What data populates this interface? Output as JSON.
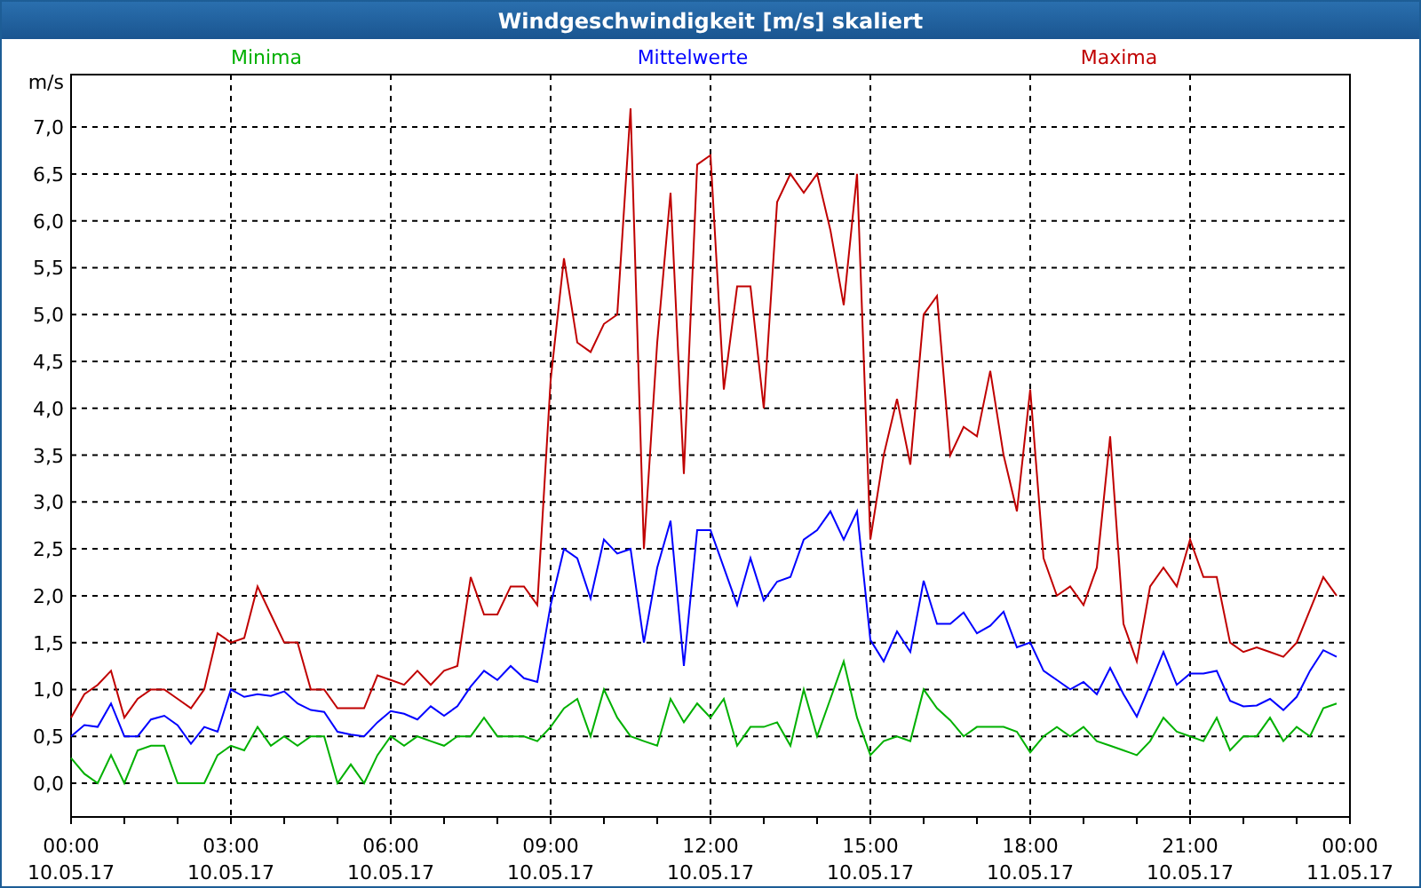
{
  "chart": {
    "chart_data": {
      "type": "line",
      "title": "Windgeschwindigkeit [m/s] skaliert",
      "ylabel": "m/s",
      "categories": [
        "00:00\n10.05.17",
        null,
        null,
        null,
        null,
        null,
        null,
        null,
        null,
        null,
        null,
        null,
        "03:00\n10.05.17",
        null,
        null,
        null,
        null,
        null,
        null,
        null,
        null,
        null,
        null,
        null,
        "06:00\n10.05.17",
        null,
        null,
        null,
        null,
        null,
        null,
        null,
        null,
        null,
        null,
        null,
        "09:00\n10.05.17",
        null,
        null,
        null,
        null,
        null,
        null,
        null,
        null,
        null,
        null,
        null,
        "12:00\n10.05.17",
        null,
        null,
        null,
        null,
        null,
        null,
        null,
        null,
        null,
        null,
        null,
        "15:00\n10.05.17",
        null,
        null,
        null,
        null,
        null,
        null,
        null,
        null,
        null,
        null,
        null,
        "18:00\n10.05.17",
        null,
        null,
        null,
        null,
        null,
        null,
        null,
        null,
        null,
        null,
        null,
        "21:00\n10.05.17",
        null,
        null,
        null,
        null,
        null,
        null,
        null,
        null,
        null,
        null,
        null,
        "00:00\n11.05.17"
      ],
      "series": [
        {
          "name": "Minima",
          "color": "#00b000",
          "values": [
            0.27,
            0.1,
            0.0,
            0.3,
            0.0,
            0.35,
            0.4,
            0.4,
            0.0,
            0.0,
            0.0,
            0.3,
            0.4,
            0.35,
            0.6,
            0.4,
            0.5,
            0.4,
            0.5,
            0.5,
            0.0,
            0.2,
            0.0,
            0.3,
            0.5,
            0.4,
            0.5,
            0.45,
            0.4,
            0.5,
            0.5,
            0.7,
            0.5,
            0.5,
            0.5,
            0.45,
            0.6,
            0.8,
            0.9,
            0.5,
            1.0,
            0.7,
            0.5,
            0.45,
            0.4,
            0.9,
            0.65,
            0.85,
            0.7,
            0.9,
            0.4,
            0.6,
            0.6,
            0.65,
            0.4,
            1.0,
            0.5,
            0.9,
            1.3,
            0.7,
            0.3,
            0.45,
            0.5,
            0.45,
            1.0,
            0.8,
            0.67,
            0.5,
            0.6,
            0.6,
            0.6,
            0.55,
            0.33,
            0.5,
            0.6,
            0.5,
            0.6,
            0.45,
            0.4,
            0.35,
            0.3,
            0.45,
            0.7,
            0.55,
            0.5,
            0.45,
            0.7,
            0.35,
            0.5,
            0.5,
            0.7,
            0.45,
            0.6,
            0.5,
            0.8,
            0.85,
            null
          ]
        },
        {
          "name": "Mittelwerte",
          "color": "#0000ff",
          "values": [
            0.5,
            0.62,
            0.6,
            0.85,
            0.5,
            0.5,
            0.68,
            0.72,
            0.62,
            0.42,
            0.6,
            0.55,
            1.0,
            0.92,
            0.95,
            0.93,
            0.98,
            0.85,
            0.78,
            0.76,
            0.55,
            0.52,
            0.5,
            0.65,
            0.77,
            0.74,
            0.68,
            0.82,
            0.72,
            0.82,
            1.03,
            1.2,
            1.1,
            1.25,
            1.12,
            1.08,
            1.9,
            2.5,
            2.4,
            1.97,
            2.6,
            2.45,
            2.5,
            1.5,
            2.3,
            2.8,
            1.25,
            2.7,
            2.7,
            2.3,
            1.9,
            2.4,
            1.95,
            2.15,
            2.2,
            2.6,
            2.7,
            2.9,
            2.6,
            2.9,
            1.53,
            1.3,
            1.62,
            1.4,
            2.16,
            1.7,
            1.7,
            1.82,
            1.6,
            1.68,
            1.83,
            1.45,
            1.5,
            1.2,
            1.1,
            1.0,
            1.08,
            0.95,
            1.23,
            0.95,
            0.71,
            1.05,
            1.4,
            1.05,
            1.17,
            1.17,
            1.2,
            0.88,
            0.82,
            0.83,
            0.9,
            0.78,
            0.92,
            1.2,
            1.42,
            1.35,
            null
          ]
        },
        {
          "name": "Maxima",
          "color": "#c00000",
          "values": [
            0.7,
            0.95,
            1.05,
            1.2,
            0.7,
            0.9,
            1.0,
            1.0,
            0.9,
            0.8,
            1.0,
            1.6,
            1.5,
            1.55,
            2.1,
            1.8,
            1.5,
            1.5,
            1.0,
            1.0,
            0.8,
            0.8,
            0.8,
            1.15,
            1.1,
            1.05,
            1.2,
            1.05,
            1.2,
            1.25,
            2.2,
            1.8,
            1.8,
            2.1,
            2.1,
            1.9,
            4.3,
            5.6,
            4.7,
            4.6,
            4.9,
            5.0,
            7.2,
            2.5,
            4.7,
            6.3,
            3.3,
            6.6,
            6.7,
            4.2,
            5.3,
            5.3,
            4.0,
            6.2,
            6.5,
            6.3,
            6.5,
            5.9,
            5.1,
            6.5,
            2.6,
            3.5,
            4.1,
            3.4,
            5.0,
            5.2,
            3.5,
            3.8,
            3.7,
            4.4,
            3.5,
            2.9,
            4.2,
            2.4,
            2.0,
            2.1,
            1.9,
            2.3,
            3.7,
            1.7,
            1.3,
            2.1,
            2.3,
            2.1,
            2.6,
            2.2,
            2.2,
            1.5,
            1.4,
            1.45,
            1.4,
            1.35,
            1.5,
            1.85,
            2.2,
            2.0,
            null
          ]
        }
      ],
      "grid": true,
      "ylim": [
        -0.36,
        7.56
      ],
      "yticks": [
        {
          "value": 0,
          "label": "0,0"
        },
        {
          "value": 0.5,
          "label": "0,5"
        },
        {
          "value": 1,
          "label": "1,0"
        },
        {
          "value": 1.5,
          "label": "1,5"
        },
        {
          "value": 2,
          "label": "2,0"
        },
        {
          "value": 2.5,
          "label": "2,5"
        },
        {
          "value": 3,
          "label": "3,0"
        },
        {
          "value": 3.5,
          "label": "3,5"
        },
        {
          "value": 4,
          "label": "4,0"
        },
        {
          "value": 4.5,
          "label": "4,5"
        },
        {
          "value": 5,
          "label": "5,0"
        },
        {
          "value": 5.5,
          "label": "5,5"
        },
        {
          "value": 6,
          "label": "6,0"
        },
        {
          "value": 6.5,
          "label": "6,5"
        },
        {
          "value": 7,
          "label": "7,0"
        }
      ]
    }
  }
}
